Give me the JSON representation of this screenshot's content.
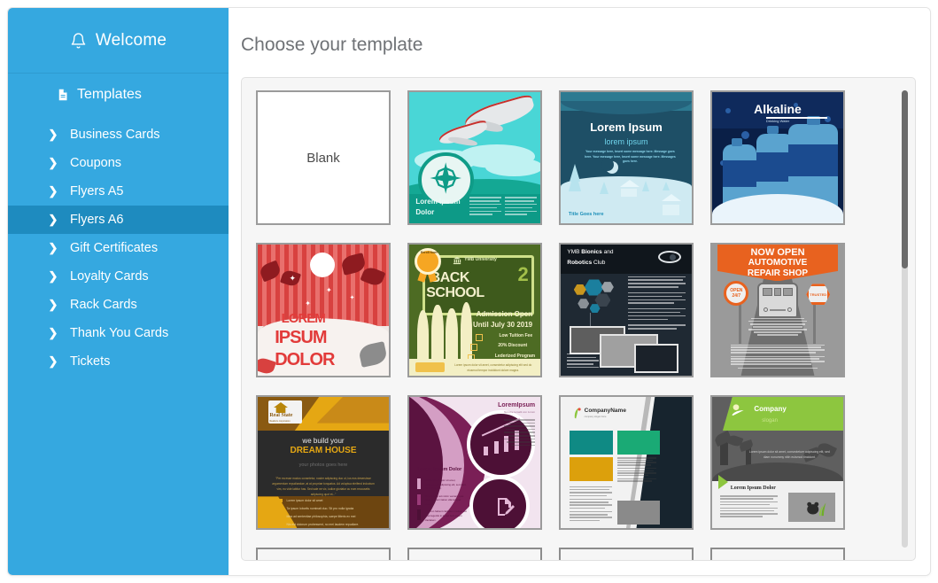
{
  "sidebar": {
    "welcome": {
      "label": "Welcome",
      "icon": "bell-icon"
    },
    "templates": {
      "label": "Templates",
      "icon": "document-icon"
    },
    "items": [
      {
        "label": "Business Cards",
        "icon": "chevron-right-icon",
        "active": false
      },
      {
        "label": "Coupons",
        "icon": "chevron-right-icon",
        "active": false
      },
      {
        "label": "Flyers A5",
        "icon": "chevron-right-icon",
        "active": false
      },
      {
        "label": "Flyers A6",
        "icon": "chevron-right-icon",
        "active": true
      },
      {
        "label": "Gift Certificates",
        "icon": "chevron-right-icon",
        "active": false
      },
      {
        "label": "Loyalty Cards",
        "icon": "chevron-right-icon",
        "active": false
      },
      {
        "label": "Rack Cards",
        "icon": "chevron-right-icon",
        "active": false
      },
      {
        "label": "Thank You Cards",
        "icon": "chevron-right-icon",
        "active": false
      },
      {
        "label": "Tickets",
        "icon": "chevron-right-icon",
        "active": false
      }
    ]
  },
  "main": {
    "title": "Choose your template",
    "scrollbar": {
      "name": "vertical-scrollbar",
      "thumb_position_percent": 0,
      "thumb_size_percent": 39
    }
  },
  "templates": [
    {
      "id": "blank",
      "name": "Blank",
      "label": "Blank"
    },
    {
      "id": "airplane",
      "name": "Airplane travel flyer",
      "text": {
        "title": "Lorem Ipsum",
        "subtitle": "Dolor"
      }
    },
    {
      "id": "winter",
      "name": "Winter night scene flyer",
      "text": {
        "title": "Lorem Ipsum",
        "subtitle": "lorem ipsum",
        "body": "Your message here, Insert some message here. Message goes here. Your message here, Insert some message here. Messages goes here.",
        "footer": "Title Goes here"
      }
    },
    {
      "id": "alkaline",
      "name": "Alkaline water bottles flyer",
      "text": {
        "title": "Alkaline",
        "subtitle": "Drinking Water"
      }
    },
    {
      "id": "beach",
      "name": "Beach party flyer",
      "text": {
        "line1": "LOREM",
        "line2": "IPSUM",
        "line3": "DOLOR"
      }
    },
    {
      "id": "back2school",
      "name": "Back 2 School admission flyer",
      "text": {
        "ribbon": "Enroll Now!",
        "university": "YMB University",
        "title1": "BACK",
        "title2": "2",
        "title3": "SCHOOL",
        "admission1": "Admission Open",
        "admission2": "Until July 30 2019",
        "bullets": [
          "Low Tuition Fee",
          "20% Discount",
          "Lederized Program"
        ],
        "footer": "Lorem ipsum dolor sit amet, consectetur adipiscing elit sed do eiusmod tempor incididunt dolore magna."
      }
    },
    {
      "id": "bionics",
      "name": "Bionics and Robotics Club flyer",
      "text": {
        "title1": "YMB",
        "title2": "Bionics",
        "title3": "and",
        "title4": "Robotics",
        "title5": "Club"
      }
    },
    {
      "id": "automotive",
      "name": "Automotive repair shop flyer",
      "text": {
        "line1": "NOW OPEN",
        "line2": "AUTOMOTIVE",
        "line3": "REPAIR SHOP",
        "badge_left1": "OPEN",
        "badge_left2": "24/7",
        "badge_right": "TRUSTED"
      }
    },
    {
      "id": "realstate",
      "name": "Real State dream house flyer",
      "text": {
        "brand": "Real State",
        "brand_sub": "Realtors corporation",
        "head1": "we build your",
        "head2": "DREAM HOUSE",
        "photo_placeholder": "your photos goes here",
        "bullets": [
          "Lorem ipsum dolor sit amet",
          "Ta ipsum lobortis nominati duo. Sit pro nulla ignota",
          "Mea ad sententiae philosophia, saepe litteris ex mei",
          "Nis est dolorum probessent, no mei laudem repudiare."
        ]
      }
    },
    {
      "id": "purple",
      "name": "Purple infographic flyer",
      "text": {
        "title": "LoremIpsum",
        "subtitle": "Non the temalit con zorum",
        "section": "Lorem Ipsum Dolor",
        "items": [
          "Lorem ipsum dolor sit amet, consectetuer adipiscing elit, sed diam nonummy nibh.",
          "Ut wisi enim ad minim veniam, quis nostrud exerci tation ullamcorper suscipit.",
          "Typi non habent claritatem insitam est usus legentis in iis qui facit eorum claritatem."
        ]
      }
    },
    {
      "id": "companyname",
      "name": "CompanyName corporate flyer",
      "text": {
        "brand": "CompanyName",
        "brand_sub": "company slogan here"
      }
    },
    {
      "id": "companyslogan",
      "name": "Company slogan nature flyer",
      "text": {
        "brand": "Company",
        "brand_sub": "slogan",
        "body": "Lorem ipsum dolor sit amet, consectetuer adipiscing elit, sed diam nonummy nibh euismod tincidunt.",
        "section": "Lorem Ipsum Dolor"
      }
    }
  ],
  "colors": {
    "sidebar_bg": "#35a8e0",
    "sidebar_active": "#1e8bbf",
    "panel_bg": "#f6f6f6",
    "title_text": "#6f7276",
    "card_border": "#9b9b9b",
    "scroll_thumb": "#6b6b6b"
  }
}
